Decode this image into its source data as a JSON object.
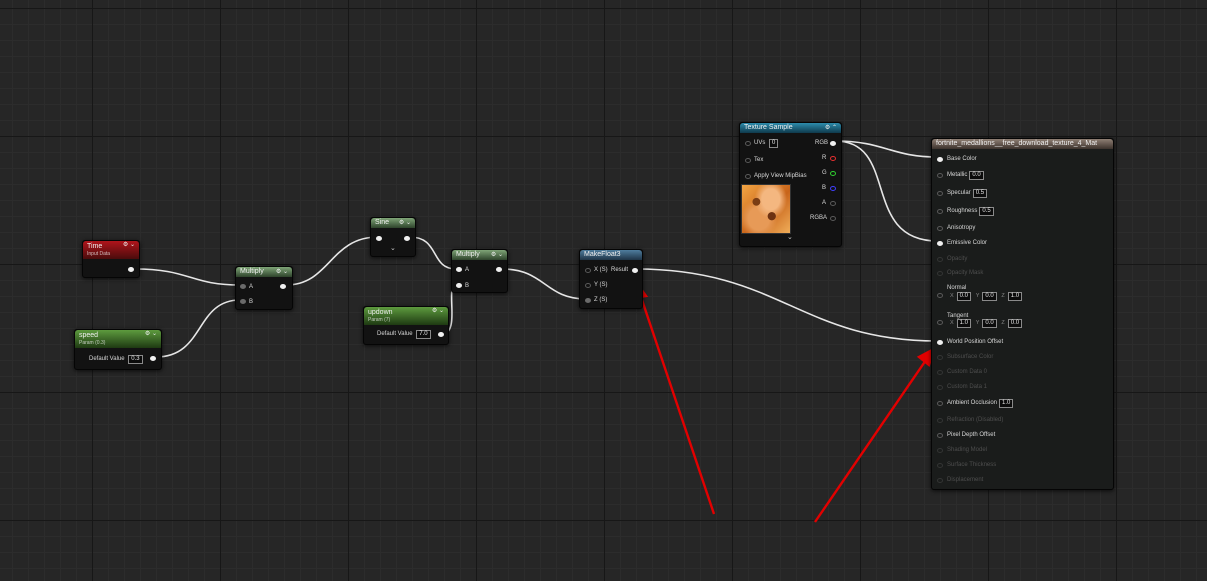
{
  "nodes": {
    "time": {
      "title": "Time",
      "subtitle": "Input Data"
    },
    "speed": {
      "title": "speed",
      "subtitle": "Param (0.3)",
      "default_label": "Default Value",
      "default_value": "0.3"
    },
    "multiply1": {
      "title": "Multiply",
      "pin_a": "A",
      "pin_b": "B"
    },
    "sine": {
      "title": "Sine"
    },
    "updown": {
      "title": "updown",
      "subtitle": "Param (7)",
      "default_label": "Default Value",
      "default_value": "7.0"
    },
    "multiply2": {
      "title": "Multiply",
      "pin_a": "A",
      "pin_b": "B"
    },
    "makefloat3": {
      "title": "MakeFloat3",
      "x": "X (S)",
      "y": "Y (S)",
      "z": "Z (S)",
      "result": "Result"
    },
    "texture": {
      "title": "Texture Sample",
      "uvs": "UVs",
      "uvs_value": "0",
      "tex": "Tex",
      "mip": "Apply View MipBias",
      "rgb": "RGB",
      "r": "R",
      "g": "G",
      "b": "B",
      "a": "A",
      "rgba": "RGBA"
    },
    "material": {
      "title": "fortnite_medallions__free_download_texture_4_Mat",
      "base_color": "Base Color",
      "metallic": "Metallic",
      "metallic_value": "0.0",
      "specular": "Specular",
      "specular_value": "0.5",
      "roughness": "Roughness",
      "roughness_value": "0.5",
      "anisotropy": "Anisotropy",
      "emissive": "Emissive Color",
      "opacity": "Opacity",
      "opacity_mask": "Opacity Mask",
      "normal": "Normal",
      "normal_x": "0.0",
      "normal_y": "0.0",
      "normal_z": "1.0",
      "tangent": "Tangent",
      "tangent_x": "1.0",
      "tangent_y": "0.0",
      "tangent_z": "0.0",
      "world_position_offset": "World Position Offset",
      "subsurface_color": "Subsurface Color",
      "custom_data0": "Custom Data 0",
      "custom_data1": "Custom Data 1",
      "ambient_occlusion": "Ambient Occlusion",
      "ambient_occlusion_value": "1.0",
      "refraction": "Refraction (Disabled)",
      "pixel_depth_offset": "Pixel Depth Offset",
      "shading_model": "Shading Model",
      "surface_thickness": "Surface Thickness",
      "displacement": "Displacement",
      "axis_x": "X",
      "axis_y": "Y",
      "axis_z": "Z"
    }
  },
  "icons": {
    "collapse": "chevron-down-icon",
    "preview": "preview-toggle-icon",
    "annotation": "red-arrow-annotation"
  },
  "colors": {
    "canvas": "#262626",
    "wire": "#e8e8e8",
    "annotation_arrow": "#e00000"
  }
}
